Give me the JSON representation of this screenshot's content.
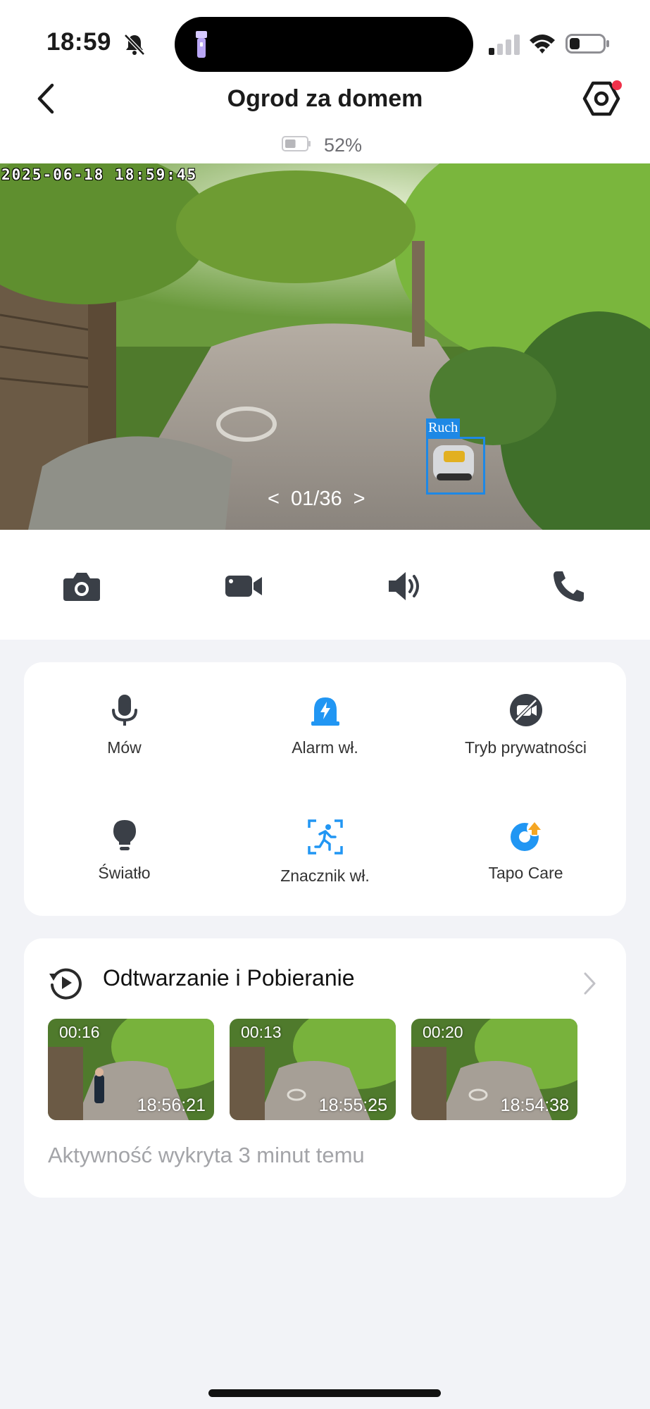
{
  "status_bar": {
    "time": "18:59",
    "icons": [
      "bell-slash-icon",
      "flashlight-icon",
      "cellular-signal-icon",
      "wifi-icon",
      "battery-icon"
    ]
  },
  "header": {
    "title": "Ogrod za domem",
    "back_icon": "chevron-left-icon",
    "settings_icon": "gear-icon",
    "settings_badge_color": "#f0314a"
  },
  "camera_battery": {
    "text": "52%",
    "level": 0.52
  },
  "feed": {
    "timestamp": "2025-06-18 18:59:45",
    "detection_label": "Ruch",
    "pager": {
      "prev": "<",
      "current": "01/36",
      "next": ">"
    }
  },
  "action_bar": {
    "items": [
      {
        "icon": "camera-icon"
      },
      {
        "icon": "video-record-icon"
      },
      {
        "icon": "speaker-icon"
      },
      {
        "icon": "phone-icon"
      }
    ]
  },
  "controls": {
    "accent_color": "#2196f3",
    "items": [
      {
        "label": "Mów",
        "icon": "microphone-icon"
      },
      {
        "label": "Alarm wł.",
        "icon": "alarm-siren-icon"
      },
      {
        "label": "Tryb prywatności",
        "icon": "privacy-camera-off-icon"
      },
      {
        "label": "Światło",
        "icon": "lightbulb-icon"
      },
      {
        "label": "Znacznik wł.",
        "icon": "motion-tracking-icon"
      },
      {
        "label": "Tapo Care",
        "icon": "tapo-care-icon"
      }
    ]
  },
  "playback": {
    "title": "Odtwarzanie i Pobieranie",
    "icon": "playback-history-icon",
    "clips": [
      {
        "duration": "00:16",
        "time": "18:56:21"
      },
      {
        "duration": "00:13",
        "time": "18:55:25"
      },
      {
        "duration": "00:20",
        "time": "18:54:38"
      }
    ],
    "activity": "Aktywność wykryta 3 minut temu"
  }
}
